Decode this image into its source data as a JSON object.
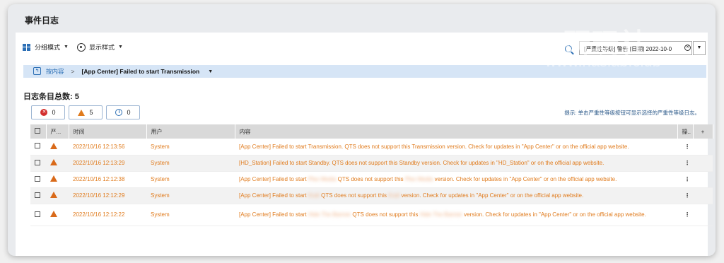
{
  "page_title": "事件日志",
  "toolbar": {
    "group_mode_label": "分组模式",
    "display_style_label": "显示样式",
    "filter_value": "[严重性等级] 警告 [日期] 2022-10-0"
  },
  "breadcrumb": {
    "root_label": "按内容",
    "separator": ">",
    "current_label": "[App Center] Failed to start Transmission"
  },
  "total": {
    "label": "日志条目总数:",
    "count": "5"
  },
  "severity_filters": {
    "error_count": "0",
    "warning_count": "5",
    "info_count": "0"
  },
  "hint_text": "提示: 单击严重性等级按钮可显示选择的严重性等级日志。",
  "table": {
    "headers": {
      "severity": "严...",
      "time": "时间",
      "user": "用户",
      "content": "内容",
      "action": "操..",
      "add": "+"
    },
    "rows": [
      {
        "time": "2022/10/16 12:13:56",
        "user": "System",
        "content_a": "[App Center] Failed to start Transmission. QTS does not support this Transmission version. Check for updates in \"App Center\" or on the official app website.",
        "more": "⋮"
      },
      {
        "time": "2022/10/16 12:13:29",
        "user": "System",
        "content_a": "[HD_Station] Failed to start Standby. QTS does not support this Standby version. Check for updates in \"HD_Station\" or on the official app website.",
        "more": "⋮"
      },
      {
        "time": "2022/10/16 12:12:38",
        "user": "System",
        "content_a": "[App Center] Failed to start",
        "content_blur1": "Plex Media",
        "content_b": "QTS does not support this",
        "content_blur2": "Plex Media",
        "content_c": "version. Check for updates in \"App Center\" or on the official app website.",
        "more": "⋮"
      },
      {
        "time": "2022/10/16 12:12:29",
        "user": "System",
        "content_a": "[App Center] Failed to start",
        "content_blur1": "Kodi",
        "content_b": "QTS does not support this",
        "content_blur2": "Kodi",
        "content_c": "version. Check for updates in \"App Center\" or on the official app website.",
        "more": "⋮"
      },
      {
        "time": "2022/10/16 12:12:22",
        "user": "System",
        "content_a": "[App Center] Failed to start",
        "content_blur1": "Hide The Banner",
        "content_b": "QTS does not support this",
        "content_blur2": "Hide The Banner",
        "content_c": "version. Check for updates in \"App Center\" or on the official app website.",
        "more": "⋮"
      }
    ]
  },
  "watermark": {
    "line1": "NAS研玩社",
    "line2": "www.naslab.club"
  },
  "colors": {
    "accent": "#2c6fb5",
    "warning": "#e07b1d",
    "error": "#d32f2f",
    "breadcrumb_bg": "#d6e5f6"
  }
}
